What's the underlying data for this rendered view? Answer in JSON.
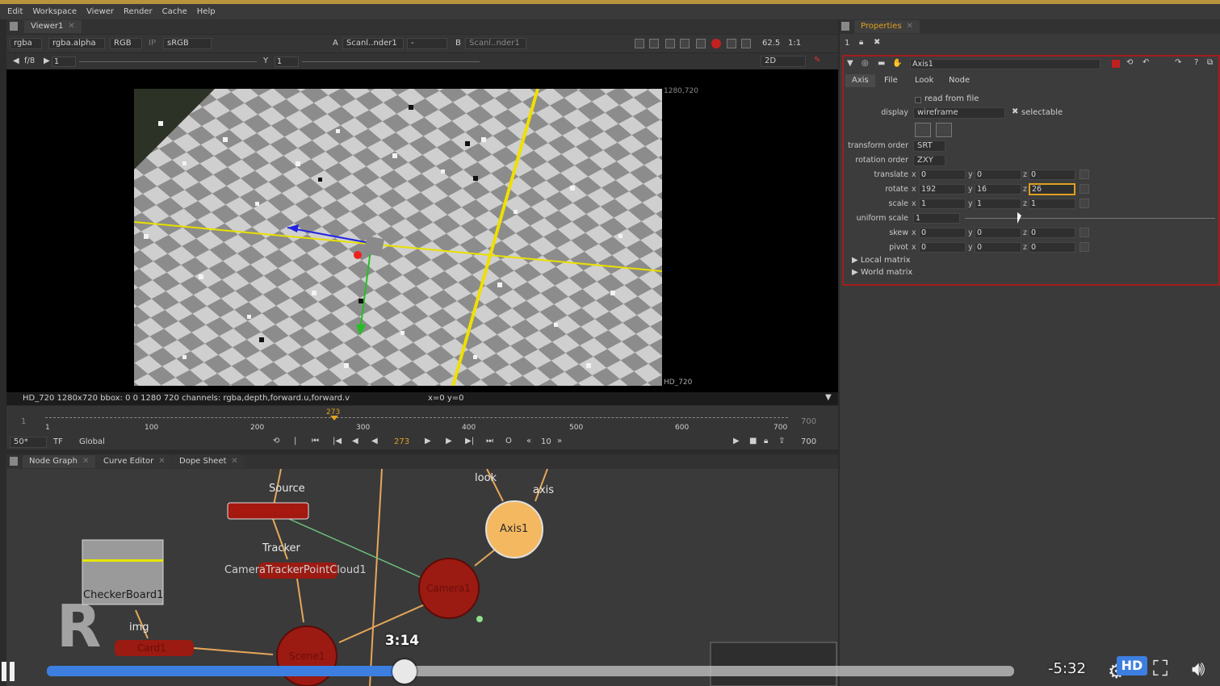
{
  "menu": [
    "Edit",
    "Workspace",
    "Viewer",
    "Render",
    "Cache",
    "Help"
  ],
  "viewer": {
    "tab_label": "Viewer1",
    "toolbar1": {
      "channels": "rgba",
      "alpha": "rgba.alpha",
      "colorspace": "RGB",
      "lut": "sRGB",
      "input_a_label": "A",
      "input_a": "Scanl..nder1",
      "dash": "-",
      "input_b_label": "B",
      "input_b": "Scanl..nder1",
      "zoom": "62.5",
      "ratio": "1:1"
    },
    "toolbar2": {
      "fstop": "f/8",
      "frame": "1",
      "y_label": "Y",
      "y_value": "1",
      "mode": "2D"
    },
    "format_tr": "1280,720",
    "format_br": "HD_720",
    "status_left": "HD_720 1280x720  bbox: 0 0 1280 720 channels: rgba,depth,forward.u,forward.v",
    "status_coords": "x=0 y=0"
  },
  "timeline": {
    "start": "1",
    "end": "700",
    "current": "273",
    "ticks": [
      "1",
      "100",
      "200",
      "300",
      "400",
      "500",
      "600",
      "700"
    ],
    "zoom": "50*",
    "tf": "TF",
    "scope": "Global",
    "increment": "10",
    "end_frame": "700"
  },
  "nodegraph": {
    "tabs": [
      "Node Graph",
      "Curve Editor",
      "Dope Sheet"
    ],
    "labels": {
      "source": "Source",
      "camera_tracker": "CameraTracker",
      "tracker": "Tracker",
      "point_cloud": "CameraTrackerPointCloud1",
      "checkerboard": "CheckerBoard1",
      "img": "img",
      "card": "Card1",
      "scene": "Scene1",
      "axis": "Axis1",
      "camera": "Camera1",
      "look": "look",
      "axis_input": "axis"
    }
  },
  "properties": {
    "tab_label": "Properties",
    "node_name": "Axis1",
    "tabs": [
      "Axis",
      "File",
      "Look",
      "Node"
    ],
    "read_from_file": "read from file",
    "display_label": "display",
    "display_value": "wireframe",
    "selectable": "selectable",
    "transform_order_label": "transform order",
    "transform_order": "SRT",
    "rotation_order_label": "rotation order",
    "rotation_order": "ZXY",
    "rows": [
      {
        "label": "translate",
        "x": "0",
        "y": "0",
        "z": "0"
      },
      {
        "label": "rotate",
        "x": "192",
        "y": "16",
        "z": "26"
      },
      {
        "label": "scale",
        "x": "1",
        "y": "1",
        "z": "1"
      }
    ],
    "uniform_scale_label": "uniform scale",
    "uniform_scale": "1",
    "rows2": [
      {
        "label": "skew",
        "x": "0",
        "y": "0",
        "z": "0"
      },
      {
        "label": "pivot",
        "x": "0",
        "y": "0",
        "z": "0"
      }
    ],
    "local_matrix": "Local matrix",
    "world_matrix": "World matrix"
  },
  "video": {
    "tooltip_time": "3:14",
    "remaining": "-5:32",
    "hd": "HD",
    "progress": 0.37
  },
  "colors": {
    "accent_red": "#a41d1d",
    "node_red": "#9b1a12",
    "axis_node": "#f4b860",
    "progress_blue": "#3c7fe0"
  }
}
